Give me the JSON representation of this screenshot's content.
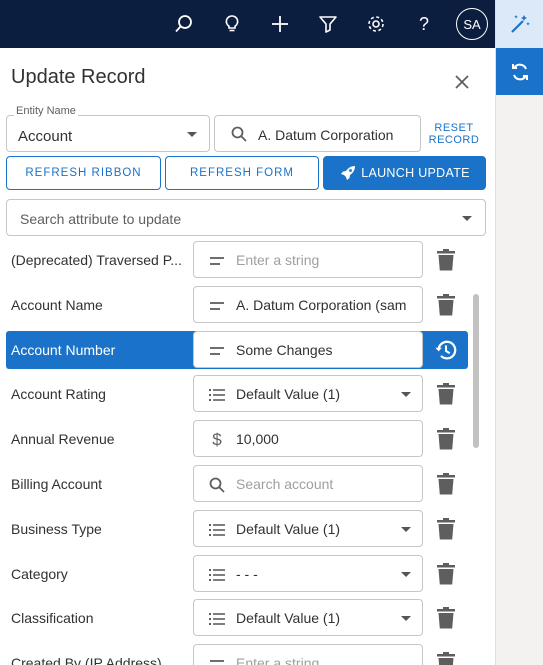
{
  "topbar": {
    "icons": [
      "search-icon",
      "lightbulb-icon",
      "plus-icon",
      "filter-icon",
      "gear-icon",
      "help-icon"
    ],
    "avatar_initials": "SA"
  },
  "rightbar": {
    "icons": [
      "magic-wand-icon",
      "sync-icon"
    ]
  },
  "panel": {
    "title": "Update Record",
    "entity_label": "Entity Name",
    "entity_value": "Account",
    "record_search_value": "A. Datum Corporation",
    "reset_label_line1": "RESET",
    "reset_label_line2": "RECORD",
    "refresh_ribbon": "REFRESH RIBBON",
    "refresh_form": "REFRESH FORM",
    "launch_update": "LAUNCH UPDATE",
    "search_attr_placeholder": "Search attribute to update"
  },
  "rows": [
    {
      "label": "(Deprecated) Traversed P...",
      "type": "text",
      "value": "Enter a string",
      "placeholder": true,
      "action": "delete"
    },
    {
      "label": "Account Name",
      "type": "text",
      "value": "A. Datum Corporation (sam",
      "placeholder": false,
      "action": "delete"
    },
    {
      "label": "Account Number",
      "type": "text",
      "value": "Some Changes",
      "placeholder": false,
      "action": "restore",
      "selected": true
    },
    {
      "label": "Account Rating",
      "type": "option",
      "value": "Default Value (1)",
      "placeholder": false,
      "action": "delete"
    },
    {
      "label": "Annual Revenue",
      "type": "money",
      "value": "10,000",
      "placeholder": false,
      "action": "delete"
    },
    {
      "label": "Billing Account",
      "type": "lookup",
      "value": "Search account",
      "placeholder": true,
      "action": "delete"
    },
    {
      "label": "Business Type",
      "type": "option",
      "value": "Default Value (1)",
      "placeholder": false,
      "action": "delete"
    },
    {
      "label": "Category",
      "type": "option",
      "value": "- - -",
      "placeholder": false,
      "action": "delete"
    },
    {
      "label": "Classification",
      "type": "option",
      "value": "Default Value (1)",
      "placeholder": false,
      "action": "delete"
    },
    {
      "label": "Created By (IP Address)",
      "type": "text",
      "value": "Enter a string",
      "placeholder": true,
      "action": "delete"
    }
  ],
  "colors": {
    "accent": "#1a73c9",
    "topbar": "#0b1e3f"
  }
}
